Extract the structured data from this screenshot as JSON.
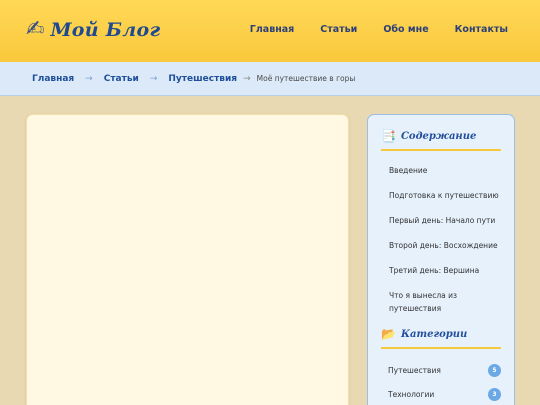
{
  "header": {
    "logo_icon": "✍",
    "logo_text": "Мой Блог",
    "nav": [
      "Главная",
      "Статьи",
      "Обо мне",
      "Контакты"
    ]
  },
  "breadcrumb": {
    "items": [
      "Главная",
      "Статьи",
      "Путешествия"
    ],
    "separator": "→",
    "current": "Моё путешествие в горы"
  },
  "sidebar": {
    "toc_title": "Содержание",
    "toc_icon": "📑",
    "toc_items": [
      "Введение",
      "Подготовка к путешествию",
      "Первый день: Начало пути",
      "Второй день: Восхождение",
      "Третий день: Вершина",
      "Что я вынесла из путешествия"
    ],
    "categories_title": "Категории",
    "categories_icon": "📂",
    "categories": [
      {
        "label": "Путешествия",
        "count": "5"
      },
      {
        "label": "Технологии",
        "count": "3"
      }
    ]
  },
  "colors": {
    "header_bg": "#f9c83b",
    "accent_blue": "#1f4a8f",
    "badge": "#6aa8e6"
  }
}
